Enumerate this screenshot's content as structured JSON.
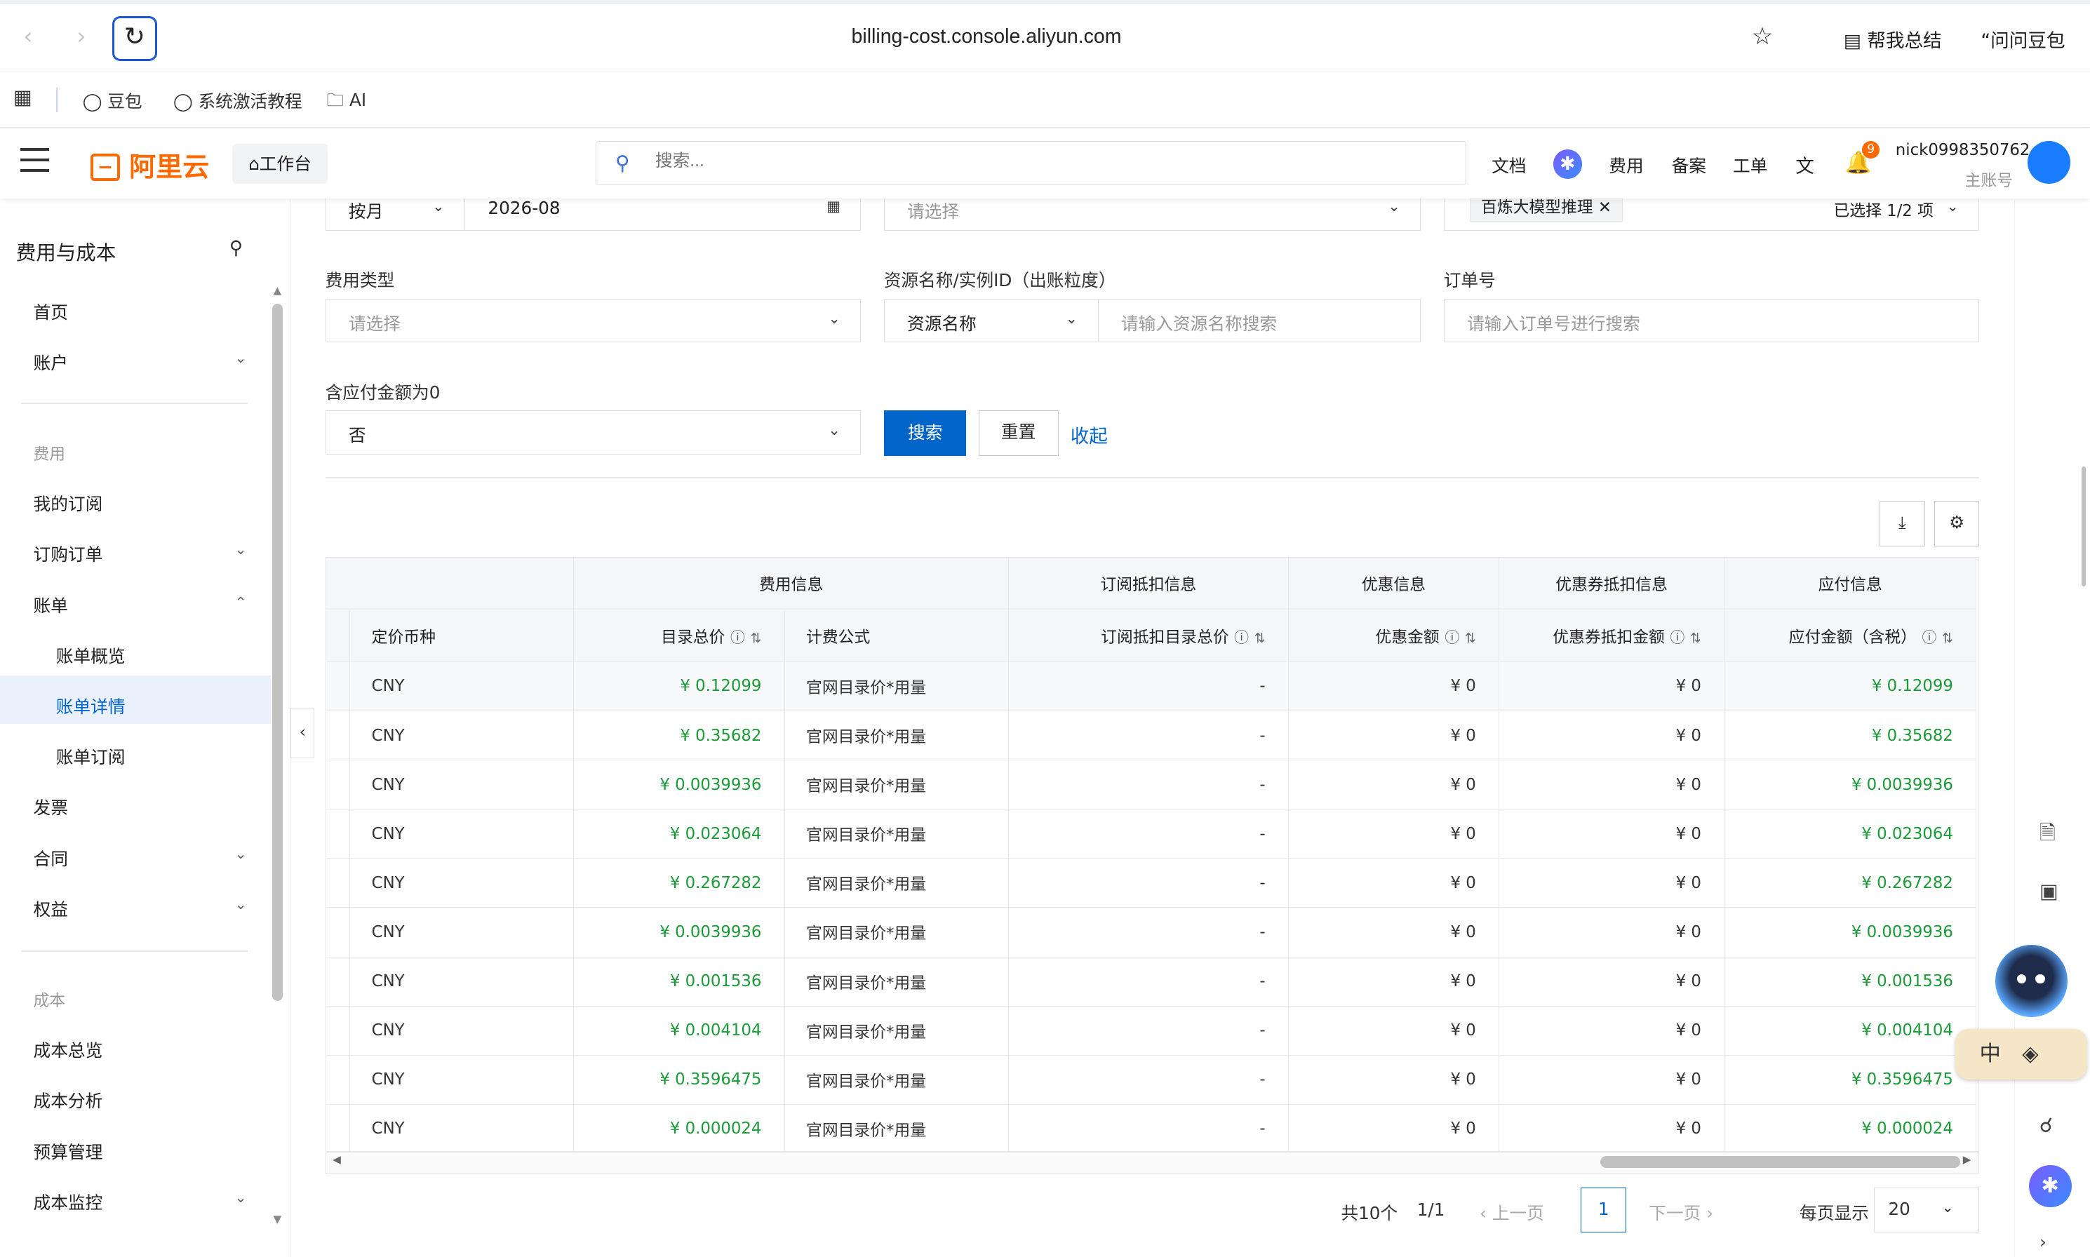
{
  "browser": {
    "url": "billing-cost.console.aliyun.com",
    "summarize_label": "帮我总结",
    "ask_label": "问问豆包",
    "bookmarks": [
      "豆包",
      "系统激活教程",
      "AI"
    ]
  },
  "header": {
    "logo_text": "阿里云",
    "workbench_label": "工作台",
    "search_placeholder": "搜索...",
    "links": [
      "文档",
      "费用",
      "备案",
      "工单"
    ],
    "notification_count": "9",
    "username": "nick0998350762",
    "role": "主账号"
  },
  "sidebar": {
    "title": "费用与成本",
    "items": [
      {
        "label": "首页"
      },
      {
        "label": "账户"
      },
      {
        "label": "费用"
      },
      {
        "label": "我的订阅"
      },
      {
        "label": "订购订单"
      },
      {
        "label": "账单"
      },
      {
        "label": "账单概览"
      },
      {
        "label": "账单详情"
      },
      {
        "label": "账单订阅"
      },
      {
        "label": "发票"
      },
      {
        "label": "合同"
      },
      {
        "label": "权益"
      },
      {
        "label": "成本"
      },
      {
        "label": "成本总览"
      },
      {
        "label": "成本分析"
      },
      {
        "label": "预算管理"
      },
      {
        "label": "成本监控"
      }
    ]
  },
  "filters": {
    "period_type": "按月",
    "period_value": "2026-08",
    "product_placeholder": "请选择",
    "selected_tag": "百炼大模型推理",
    "selected_count": "已选择 1/2 项",
    "fee_type_label": "费用类型",
    "fee_type_placeholder": "请选择",
    "resource_label": "资源名称/实例ID（出账粒度）",
    "resource_type": "资源名称",
    "resource_placeholder": "请输入资源名称搜索",
    "order_label": "订单号",
    "order_placeholder": "请输入订单号进行搜索",
    "zero_label": "含应付金额为0",
    "zero_value": "否",
    "search_btn": "搜索",
    "reset_btn": "重置",
    "collapse_btn": "收起"
  },
  "table": {
    "groups": [
      "费用信息",
      "订阅抵扣信息",
      "优惠信息",
      "优惠券抵扣信息",
      "应付信息"
    ],
    "columns": [
      "定价币种",
      "目录总价",
      "计费公式",
      "订阅抵扣目录总价",
      "优惠金额",
      "优惠券抵扣金额",
      "应付金额（含税）"
    ],
    "rows": [
      [
        "CNY",
        "¥ 0.12099",
        "官网目录价*用量",
        "-",
        "¥ 0",
        "¥ 0",
        "¥ 0.12099"
      ],
      [
        "CNY",
        "¥ 0.35682",
        "官网目录价*用量",
        "-",
        "¥ 0",
        "¥ 0",
        "¥ 0.35682"
      ],
      [
        "CNY",
        "¥ 0.0039936",
        "官网目录价*用量",
        "-",
        "¥ 0",
        "¥ 0",
        "¥ 0.0039936"
      ],
      [
        "CNY",
        "¥ 0.023064",
        "官网目录价*用量",
        "-",
        "¥ 0",
        "¥ 0",
        "¥ 0.023064"
      ],
      [
        "CNY",
        "¥ 0.267282",
        "官网目录价*用量",
        "-",
        "¥ 0",
        "¥ 0",
        "¥ 0.267282"
      ],
      [
        "CNY",
        "¥ 0.0039936",
        "官网目录价*用量",
        "-",
        "¥ 0",
        "¥ 0",
        "¥ 0.0039936"
      ],
      [
        "CNY",
        "¥ 0.001536",
        "官网目录价*用量",
        "-",
        "¥ 0",
        "¥ 0",
        "¥ 0.001536"
      ],
      [
        "CNY",
        "¥ 0.004104",
        "官网目录价*用量",
        "-",
        "¥ 0",
        "¥ 0",
        "¥ 0.004104"
      ],
      [
        "CNY",
        "¥ 0.3596475",
        "官网目录价*用量",
        "-",
        "¥ 0",
        "¥ 0",
        "¥ 0.3596475"
      ],
      [
        "CNY",
        "¥ 0.000024",
        "官网目录价*用量",
        "-",
        "¥ 0",
        "¥ 0",
        "¥ 0.000024"
      ]
    ]
  },
  "pagination": {
    "total": "共10个",
    "pages": "1/1",
    "prev": "上一页",
    "current": "1",
    "next": "下一页",
    "page_size_label": "每页显示",
    "page_size": "20"
  },
  "ime": {
    "label": "中"
  },
  "colors": {
    "accent": "#0064c8",
    "brand": "#ff6a00",
    "amount": "#1a9b38"
  }
}
